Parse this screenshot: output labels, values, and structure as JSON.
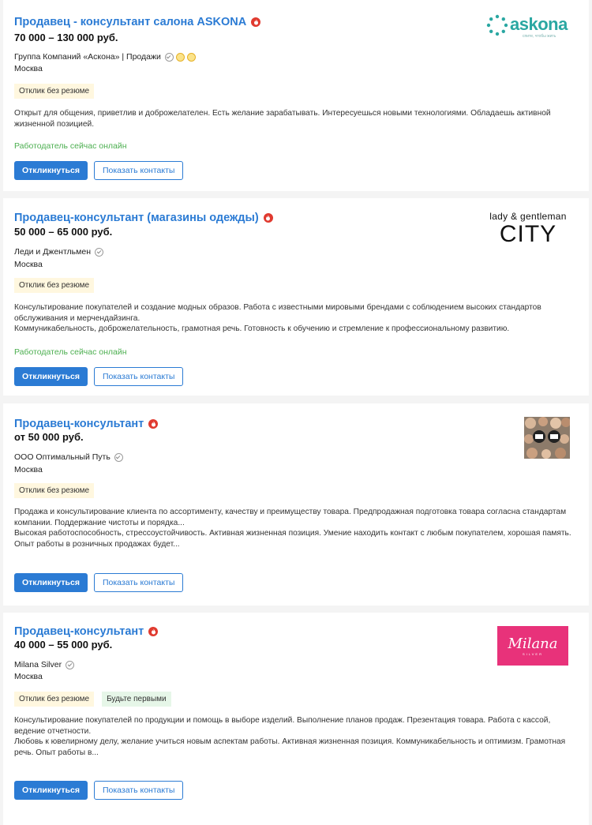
{
  "vacancies": [
    {
      "title": "Продавец - консультант салона ASKONA",
      "salary": "70 000 – 130 000 руб.",
      "company": "Группа Компаний «Аскона» | Продажи",
      "city": "Москва",
      "badges": [
        "Отклик без резюме"
      ],
      "description": [
        "Открыт для общения, приветлив и доброжелателен. Есть желание зарабатывать. Интересуешься новыми технологиями. Обладаешь активной жизненной позицией."
      ],
      "online": "Работодатель сейчас онлайн",
      "respond_label": "Откликнуться",
      "contacts_label": "Показать контакты",
      "logo": {
        "word": "askona",
        "tagline": "спите, чтобы жить"
      }
    },
    {
      "title": "Продавец-консультант (магазины одежды)",
      "salary": "50 000 – 65 000 руб.",
      "company": "Леди и Джентльмен",
      "city": "Москва",
      "badges": [
        "Отклик без резюме"
      ],
      "description": [
        "Консультирование покупателей и создание модных образов. Работа с известными мировыми брендами с соблюдением высоких стандартов обслуживания и мерчендайзинга.",
        "Коммуникабельность, доброжелательность, грамотная речь. Готовность к обучению и стремление к профессиональному развитию."
      ],
      "online": "Работодатель сейчас онлайн",
      "respond_label": "Откликнуться",
      "contacts_label": "Показать контакты",
      "logo": {
        "top": "lady & gentleman",
        "big": "CITY"
      }
    },
    {
      "title": "Продавец-консультант",
      "salary": "от 50 000 руб.",
      "company": "ООО Оптимальный Путь",
      "city": "Москва",
      "badges": [
        "Отклик без резюме"
      ],
      "description": [
        "Продажа и консультирование клиента по ассортименту, качеству и преимуществу товара. Предпродажная подготовка товара согласна стандартам компании. Поддержание чистоты и порядка...",
        "Высокая работоспособность, стрессоустойчивость. Активная жизненная позиция. Умение находить контакт с любым покупателем, хорошая память. Опыт работы в розничных продажах будет..."
      ],
      "respond_label": "Откликнуться",
      "contacts_label": "Показать контакты"
    },
    {
      "title": "Продавец-консультант",
      "salary": "40 000 – 55 000 руб.",
      "company": "Milana Silver",
      "city": "Москва",
      "badges": [
        "Отклик без резюме",
        "Будьте первыми"
      ],
      "description": [
        "Консультирование покупателей по продукции и помощь в выборе изделий. Выполнение планов продаж. Презентация товара. Работа с кассой, ведение отчетности.",
        "Любовь к ювелирному делу, желание учиться новым аспектам работы. Активная жизненная позиция. Коммуникабельность и оптимизм. Грамотная речь. Опыт работы в..."
      ],
      "respond_label": "Откликнуться",
      "contacts_label": "Показать контакты",
      "logo": {
        "word": "Milana",
        "sub": "SILVER"
      }
    }
  ],
  "colors": {
    "link": "#2b7bd4",
    "online": "#4caf50",
    "hot": "#e03a2f",
    "badge_bg": "#fff7df",
    "badge_green_bg": "#e6f6e8"
  },
  "icons": {
    "hot": "fire-icon",
    "verified": "check-circle-icon",
    "medal": "medal-icon"
  }
}
